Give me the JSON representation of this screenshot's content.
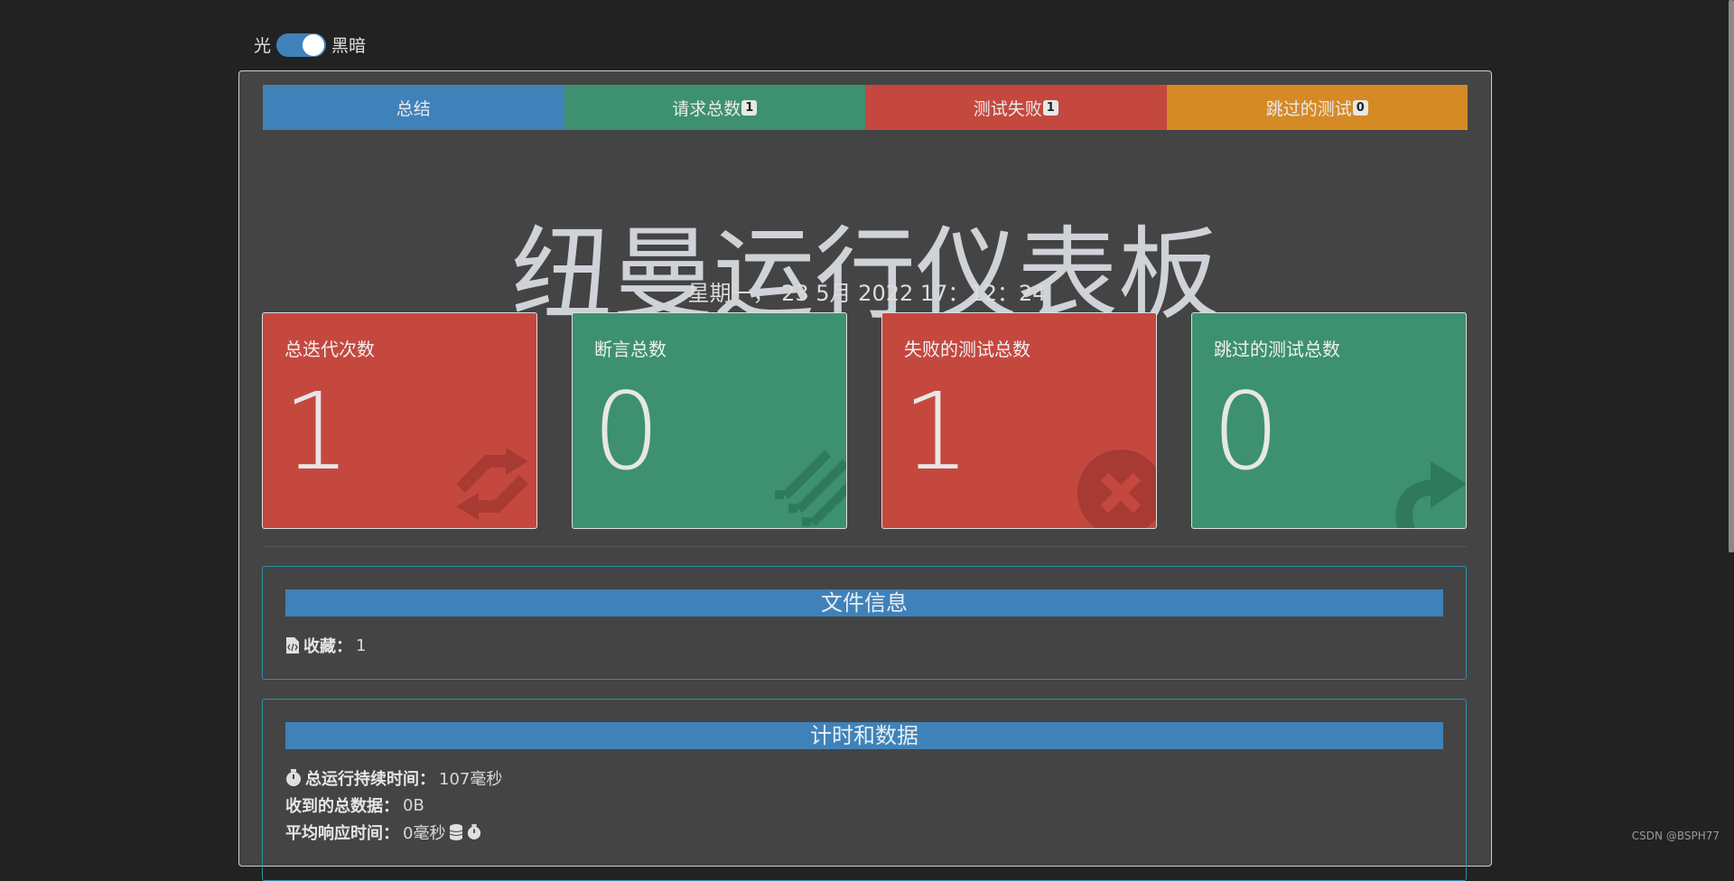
{
  "theme": {
    "light_label": "光",
    "dark_label": "黑暗",
    "dark_enabled": true
  },
  "tabs": [
    {
      "label": "总结",
      "badge": "",
      "color": "#3f82b9"
    },
    {
      "label": "请求总数",
      "badge": "1",
      "color": "#3d9170"
    },
    {
      "label": "测试失败",
      "badge": "1",
      "color": "#c5483f"
    },
    {
      "label": "跳过的测试",
      "badge": "0",
      "color": "#d58a25"
    }
  ],
  "header": {
    "title": "纽曼运行仪表板",
    "datetime": "星期一， 23 5月 2022 17：12：24"
  },
  "cards": [
    {
      "label": "总迭代次数",
      "value": "1",
      "color": "red",
      "icon": "refresh-icon"
    },
    {
      "label": "断言总数",
      "value": "0",
      "color": "green",
      "icon": "list-icon"
    },
    {
      "label": "失败的测试总数",
      "value": "1",
      "color": "red",
      "icon": "times-circle-icon"
    },
    {
      "label": "跳过的测试总数",
      "value": "0",
      "color": "green",
      "icon": "share-arrow-icon"
    }
  ],
  "file_info": {
    "title": "文件信息",
    "collection_label": "收藏：",
    "collection_value": "1"
  },
  "timing": {
    "title": "计时和数据",
    "duration_label": "总运行持续时间：",
    "duration_value": "107毫秒",
    "data_label": "收到的总数据：",
    "data_value": "0B",
    "avg_label": "平均响应时间：",
    "avg_value": "0毫秒"
  },
  "watermark": "CSDN @BSPH77"
}
